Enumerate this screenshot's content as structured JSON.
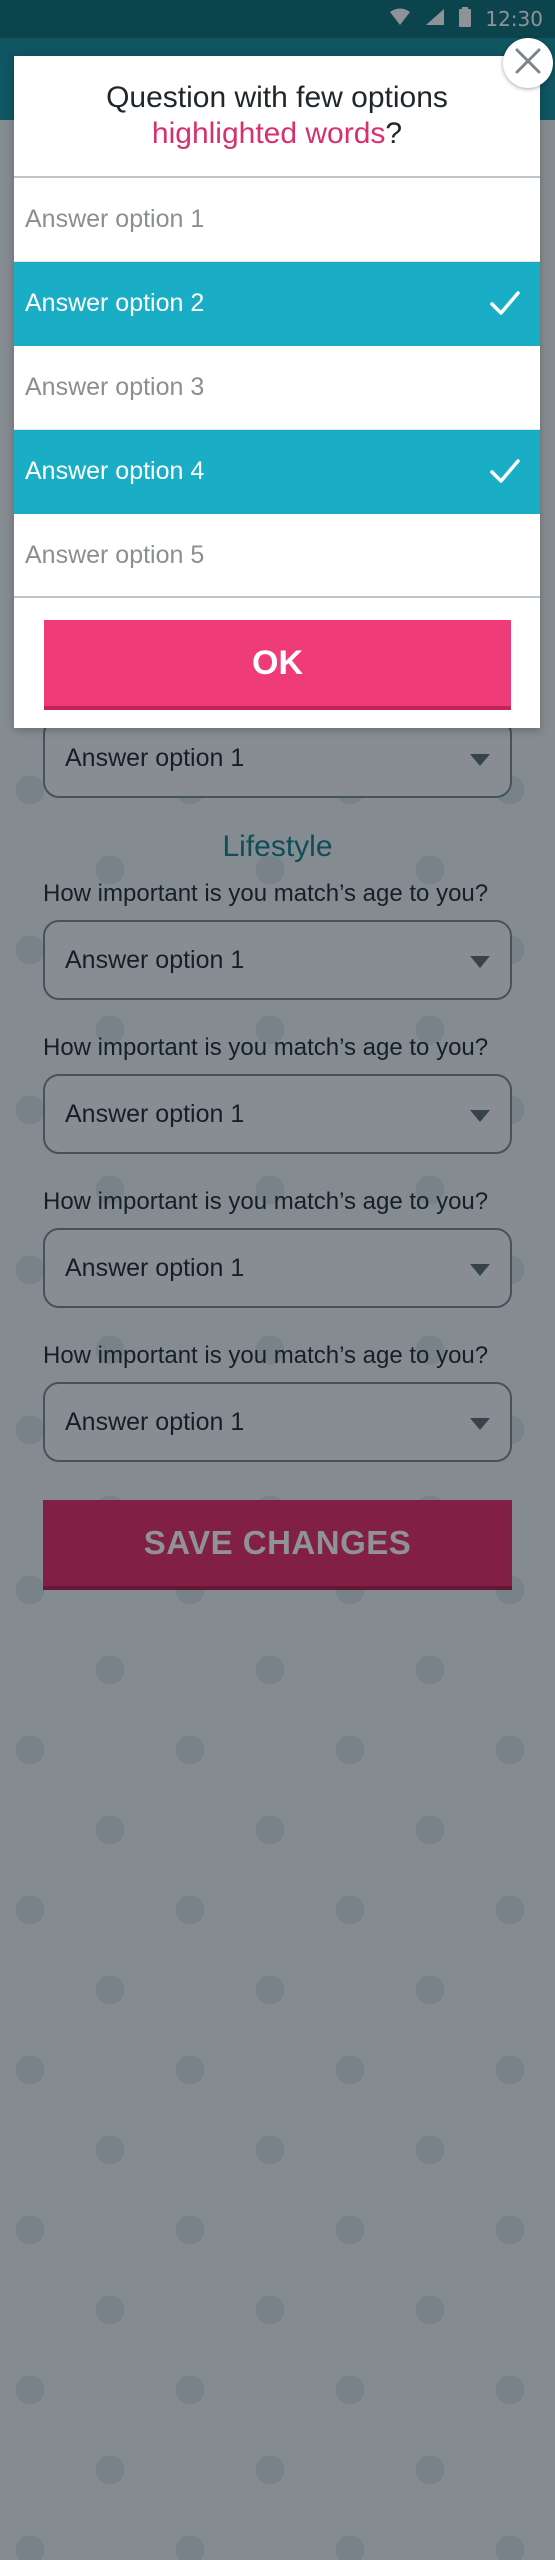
{
  "status_bar": {
    "time": "12:30",
    "icons": [
      "wifi-icon",
      "signal-icon",
      "battery-icon"
    ]
  },
  "dialog": {
    "title_line1": "Question with few options",
    "title_highlight": "highlighted words",
    "title_suffix": "?",
    "options": [
      {
        "label": "Answer option 1",
        "selected": false
      },
      {
        "label": "Answer option 2",
        "selected": true
      },
      {
        "label": "Answer option 3",
        "selected": false
      },
      {
        "label": "Answer option 4",
        "selected": true
      },
      {
        "label": "Answer option 5",
        "selected": false
      }
    ],
    "ok_label": "OK",
    "close_icon": "close-icon"
  },
  "background": {
    "first_field_value": "Answer option 1",
    "section_title": "Lifestyle",
    "questions": [
      {
        "question": "How important is you match’s age to you?",
        "value": "Answer option 1"
      },
      {
        "question": "How important is you match’s age to you?",
        "value": "Answer option 1"
      },
      {
        "question": "How important is you match’s age to you?",
        "value": "Answer option 1"
      },
      {
        "question": "How important is you match’s age to you?",
        "value": "Answer option 1"
      }
    ],
    "save_label": "SAVE CHANGES"
  },
  "colors": {
    "accent_teal": "#19aec5",
    "accent_pink": "#ef3c78",
    "highlight_text": "#d8306a",
    "header_teal": "#138f9e"
  }
}
